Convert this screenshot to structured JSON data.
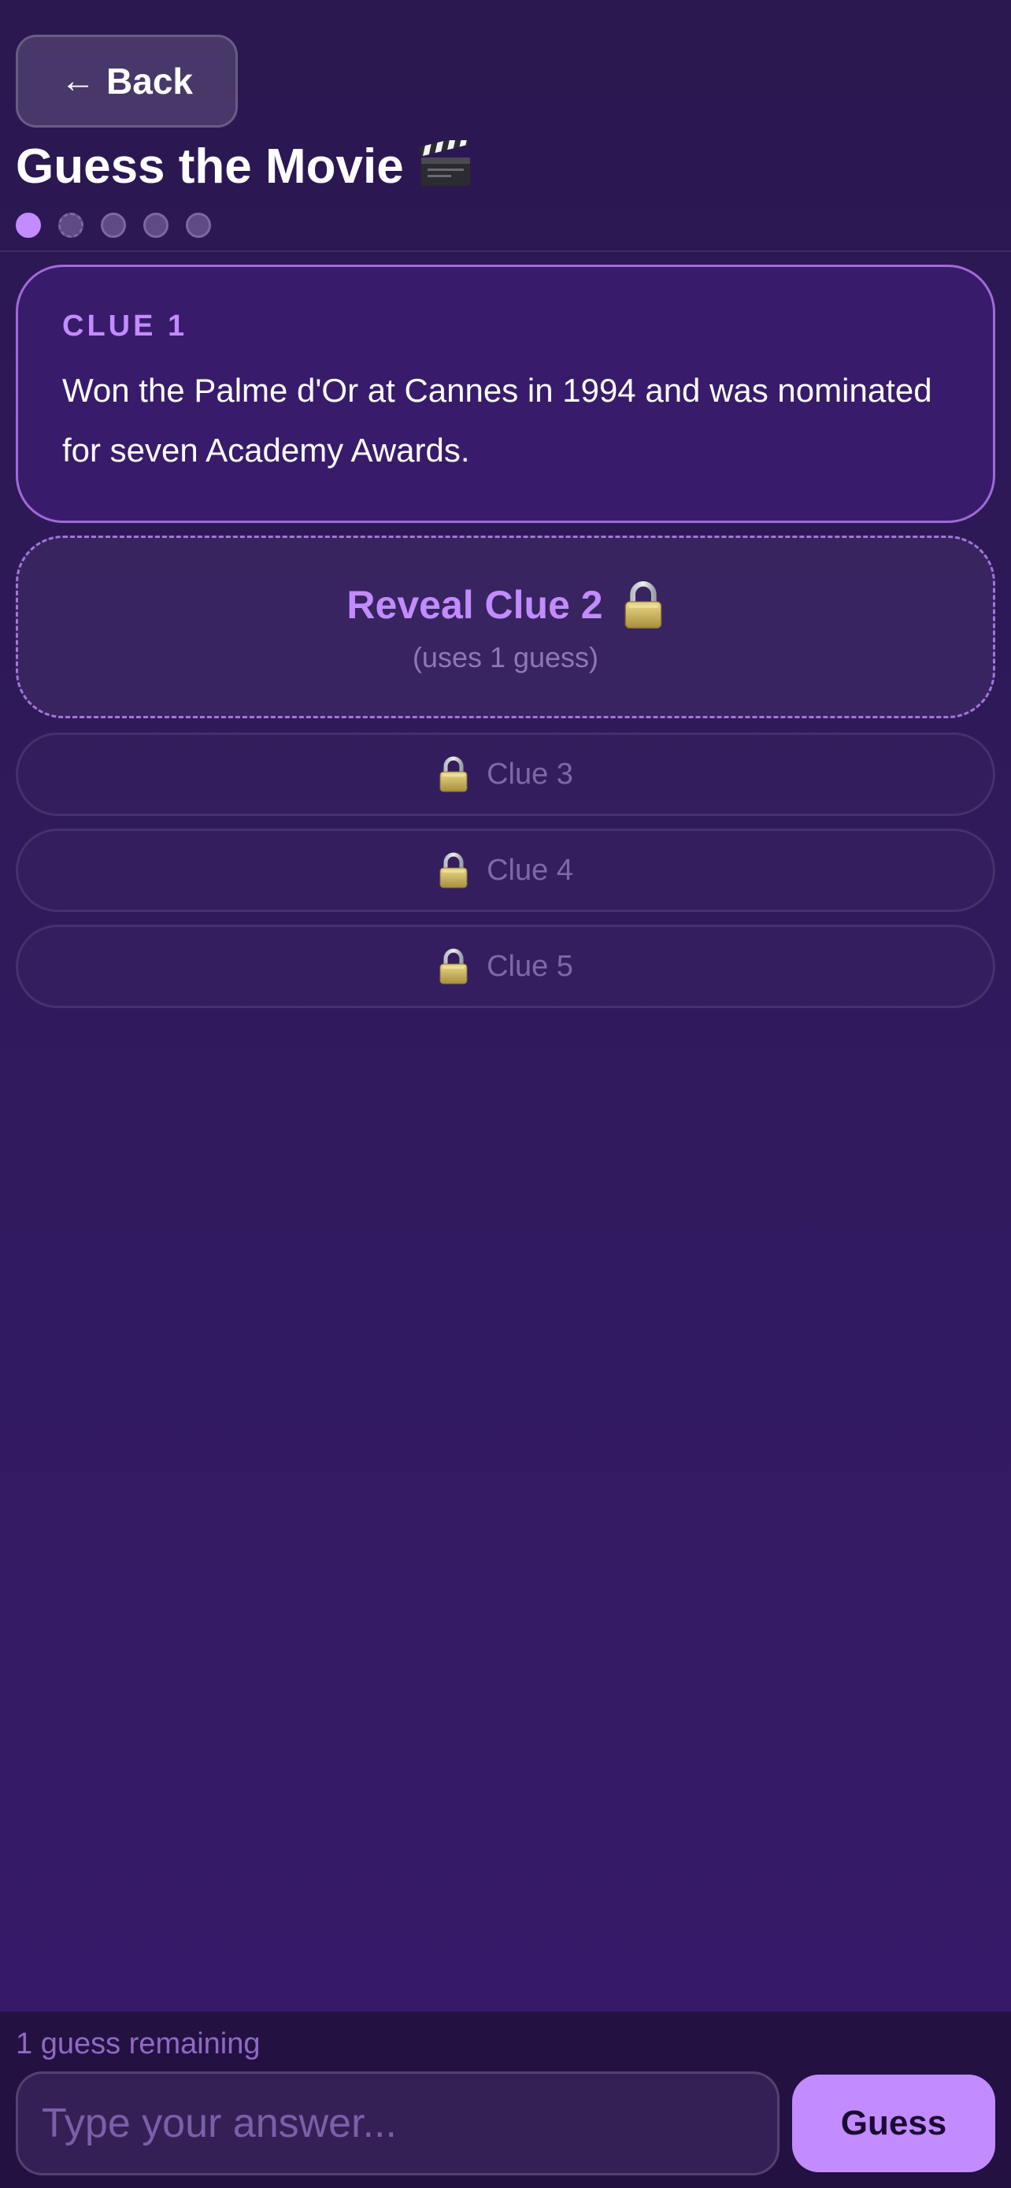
{
  "header": {
    "back_label": "Back",
    "title": "Guess the Movie",
    "progress": {
      "total": 5,
      "revealed": 1
    }
  },
  "clue": {
    "label": "CLUE 1",
    "text": "Won the Palme d'Or at Cannes in 1994 and was nominated for seven Academy Awards."
  },
  "reveal": {
    "title": "Reveal Clue 2",
    "subtitle": "(uses 1 guess)"
  },
  "locked_clues": [
    {
      "label": "Clue 3"
    },
    {
      "label": "Clue 4"
    },
    {
      "label": "Clue 5"
    }
  ],
  "footer": {
    "remaining": "1 guess remaining",
    "input_placeholder": "Type your answer...",
    "input_value": "",
    "guess_label": "Guess"
  },
  "icons": {
    "back": "arrow-left-icon",
    "title": "clapperboard-icon",
    "lock": "padlock-icon"
  },
  "colors": {
    "accent": "#c28bff",
    "background": "#2f1a5c",
    "card": "#381c6b",
    "muted": "#7e68a6"
  }
}
